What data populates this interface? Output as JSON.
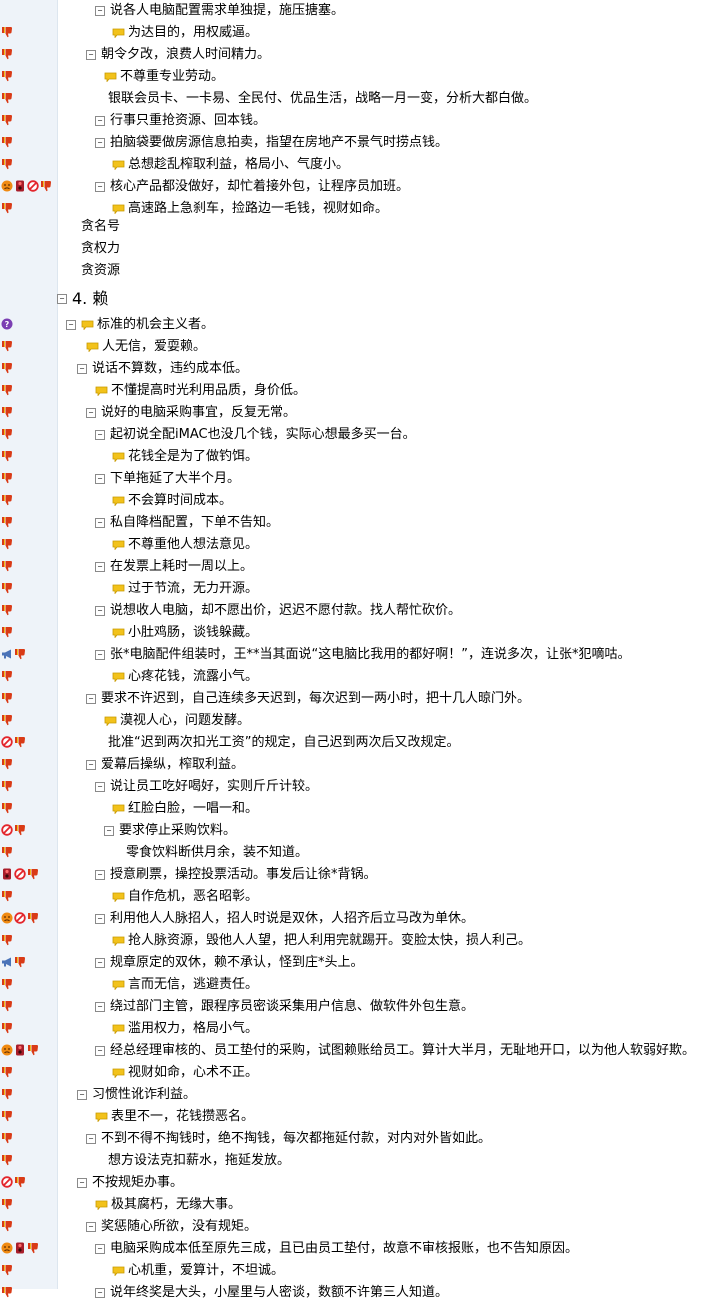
{
  "rows": [
    {
      "text": "说各人电脑配置需求单独提，施压搪塞。",
      "icons": [],
      "toggle": true,
      "note": false
    },
    {
      "text": "为达目的，用权威逼。",
      "icons": [
        "thumb-down"
      ],
      "toggle": false,
      "note": true
    },
    {
      "text": "朝令夕改，浪费人时间精力。",
      "icons": [
        "thumb-down"
      ],
      "toggle": true,
      "note": false
    },
    {
      "text": "不尊重专业劳动。",
      "icons": [
        "thumb-down"
      ],
      "toggle": false,
      "note": true
    },
    {
      "text": "银联会员卡、一卡易、全民付、优品生活，战略一月一变，分析大都白做。",
      "icons": [
        "thumb-down"
      ],
      "toggle": false,
      "note": false
    },
    {
      "text": "行事只重抢资源、回本钱。",
      "icons": [
        "thumb-down"
      ],
      "toggle": true,
      "note": false
    },
    {
      "text": "拍脑袋要做房源信息拍卖，指望在房地产不景气时捞点钱。",
      "icons": [
        "thumb-down"
      ],
      "toggle": true,
      "note": false
    },
    {
      "text": "总想趁乱榨取利益，格局小、气度小。",
      "icons": [
        "thumb-down"
      ],
      "toggle": false,
      "note": true
    },
    {
      "text": "核心产品都没做好，却忙着接外包，让程序员加班。",
      "icons": [
        "angry-face",
        "stop-light",
        "no-sign",
        "thumb-down"
      ],
      "toggle": true,
      "note": false
    },
    {
      "text": "高速路上急刹车，捡路边一毛钱，视财如命。",
      "icons": [
        "thumb-down"
      ],
      "toggle": false,
      "note": true
    },
    {
      "text": "贪名号",
      "icons": [],
      "toggle": false,
      "note": false
    },
    {
      "text": "贪权力",
      "icons": [],
      "toggle": false,
      "note": false
    },
    {
      "text": "贪资源",
      "icons": [],
      "toggle": false,
      "note": false
    },
    {
      "text": "4. 赖",
      "icons": [],
      "toggle": true,
      "note": false,
      "big": true
    },
    {
      "text": "标准的机会主义者。",
      "icons": [
        "question"
      ],
      "toggle": true,
      "note": true
    },
    {
      "text": "人无信，爱耍赖。",
      "icons": [
        "thumb-down"
      ],
      "toggle": false,
      "note": true
    },
    {
      "text": "说话不算数，违约成本低。",
      "icons": [
        "thumb-down"
      ],
      "toggle": true,
      "note": false
    },
    {
      "text": "不懂提高时光利用品质，身价低。",
      "icons": [
        "thumb-down"
      ],
      "toggle": false,
      "note": true
    },
    {
      "text": "说好的电脑采购事宜，反复无常。",
      "icons": [
        "thumb-down"
      ],
      "toggle": true,
      "note": false
    },
    {
      "text": "起初说全配iMAC也没几个钱，实际心想最多买一台。",
      "icons": [
        "thumb-down"
      ],
      "toggle": true,
      "note": false
    },
    {
      "text": "花钱全是为了做钓饵。",
      "icons": [
        "thumb-down"
      ],
      "toggle": false,
      "note": true
    },
    {
      "text": "下单拖延了大半个月。",
      "icons": [
        "thumb-down"
      ],
      "toggle": true,
      "note": false
    },
    {
      "text": "不会算时间成本。",
      "icons": [
        "thumb-down"
      ],
      "toggle": false,
      "note": true
    },
    {
      "text": "私自降档配置，下单不告知。",
      "icons": [
        "thumb-down"
      ],
      "toggle": true,
      "note": false
    },
    {
      "text": "不尊重他人想法意见。",
      "icons": [
        "thumb-down"
      ],
      "toggle": false,
      "note": true
    },
    {
      "text": "在发票上耗时一周以上。",
      "icons": [
        "thumb-down"
      ],
      "toggle": true,
      "note": false
    },
    {
      "text": "过于节流，无力开源。",
      "icons": [
        "thumb-down"
      ],
      "toggle": false,
      "note": true
    },
    {
      "text": "说想收人电脑，却不愿出价，迟迟不愿付款。找人帮忙砍价。",
      "icons": [
        "thumb-down"
      ],
      "toggle": true,
      "note": false
    },
    {
      "text": "小肚鸡肠，谈钱躲藏。",
      "icons": [
        "thumb-down"
      ],
      "toggle": false,
      "note": true
    },
    {
      "text": "张*电脑配件组装时，王**当其面说“这电脑比我用的都好啊！”，连说多次，让张*犯嘀咕。",
      "icons": [
        "megaphone",
        "thumb-down"
      ],
      "toggle": true,
      "note": false
    },
    {
      "text": "心疼花钱，流露小气。",
      "icons": [
        "thumb-down"
      ],
      "toggle": false,
      "note": true
    },
    {
      "text": "要求不许迟到，自己连续多天迟到，每次迟到一两小时，把十几人晾门外。",
      "icons": [
        "thumb-down"
      ],
      "toggle": true,
      "note": false
    },
    {
      "text": "漠视人心，问题发酵。",
      "icons": [
        "thumb-down"
      ],
      "toggle": false,
      "note": true
    },
    {
      "text": "批准“迟到两次扣光工资”的规定，自己迟到两次后又改规定。",
      "icons": [
        "no-sign",
        "thumb-down"
      ],
      "toggle": false,
      "note": false
    },
    {
      "text": "爱幕后操纵，榨取利益。",
      "icons": [
        "thumb-down"
      ],
      "toggle": true,
      "note": false
    },
    {
      "text": "说让员工吃好喝好，实则斤斤计较。",
      "icons": [
        "thumb-down"
      ],
      "toggle": true,
      "note": false
    },
    {
      "text": "红脸白脸，一唱一和。",
      "icons": [
        "thumb-down"
      ],
      "toggle": false,
      "note": true
    },
    {
      "text": "要求停止采购饮料。",
      "icons": [
        "no-sign",
        "thumb-down"
      ],
      "toggle": true,
      "note": false
    },
    {
      "text": "零食饮料断供月余，装不知道。",
      "icons": [
        "thumb-down"
      ],
      "toggle": false,
      "note": false
    },
    {
      "text": "授意刷票，操控投票活动。事发后让徐*背锅。",
      "icons": [
        "stop-light",
        "no-sign",
        "thumb-down"
      ],
      "toggle": true,
      "note": false
    },
    {
      "text": "自作危机，恶名昭彰。",
      "icons": [
        "thumb-down"
      ],
      "toggle": false,
      "note": true
    },
    {
      "text": "利用他人人脉招人，招人时说是双休，人招齐后立马改为单休。",
      "icons": [
        "angry-face",
        "no-sign",
        "thumb-down"
      ],
      "toggle": true,
      "note": false
    },
    {
      "text": "抢人脉资源，毁他人人望，把人利用完就踢开。变脸太快，损人利己。",
      "icons": [
        "thumb-down"
      ],
      "toggle": false,
      "note": true
    },
    {
      "text": "规章原定的双休，赖不承认，怪到庄*头上。",
      "icons": [
        "megaphone",
        "thumb-down"
      ],
      "toggle": true,
      "note": false
    },
    {
      "text": "言而无信，逃避责任。",
      "icons": [
        "thumb-down"
      ],
      "toggle": false,
      "note": true
    },
    {
      "text": "绕过部门主管，跟程序员密谈采集用户信息、做软件外包生意。",
      "icons": [
        "thumb-down"
      ],
      "toggle": true,
      "note": false
    },
    {
      "text": "滥用权力，格局小气。",
      "icons": [
        "thumb-down"
      ],
      "toggle": false,
      "note": true
    },
    {
      "text": "经总经理审核的、员工垫付的采购，试图赖账给员工。算计大半月，无耻地开口，以为他人软弱好欺。",
      "icons": [
        "angry-face",
        "stop-light",
        "thumb-down"
      ],
      "toggle": true,
      "note": false
    },
    {
      "text": "视财如命，心术不正。",
      "icons": [
        "thumb-down"
      ],
      "toggle": false,
      "note": true
    },
    {
      "text": "习惯性讹诈利益。",
      "icons": [
        "thumb-down"
      ],
      "toggle": true,
      "note": false
    },
    {
      "text": "表里不一，花钱攒恶名。",
      "icons": [
        "thumb-down"
      ],
      "toggle": false,
      "note": true
    },
    {
      "text": "不到不得不掏钱时，绝不掏钱，每次都拖延付款，对内对外皆如此。",
      "icons": [
        "thumb-down"
      ],
      "toggle": true,
      "note": false
    },
    {
      "text": "想方设法克扣薪水，拖延发放。",
      "icons": [
        "thumb-down"
      ],
      "toggle": false,
      "note": false
    },
    {
      "text": "不按规矩办事。",
      "icons": [
        "no-sign",
        "thumb-down"
      ],
      "toggle": true,
      "note": false
    },
    {
      "text": "极其腐朽，无缘大事。",
      "icons": [
        "thumb-down"
      ],
      "toggle": false,
      "note": true
    },
    {
      "text": "奖惩随心所欲，没有规矩。",
      "icons": [
        "thumb-down"
      ],
      "toggle": true,
      "note": false
    },
    {
      "text": "电脑采购成本低至原先三成，且已由员工垫付，故意不审核报账，也不告知原因。",
      "icons": [
        "angry-face",
        "stop-light",
        "thumb-down"
      ],
      "toggle": true,
      "note": false
    },
    {
      "text": "心机重，爱算计，不坦诚。",
      "icons": [
        "thumb-down"
      ],
      "toggle": false,
      "note": true
    },
    {
      "text": "说年终奖是大头，小屋里与人密谈，数额不许第三人知道。",
      "icons": [
        "thumb-down"
      ],
      "toggle": true,
      "note": false
    }
  ],
  "toggle_symbol": "⊟",
  "colors": {
    "gutter": "#eef3f9",
    "thumb": "#d93a16",
    "note": "#f2c21b",
    "question": "#7b3fb3",
    "angry": "#f08a12",
    "stop": "#a81d2a",
    "no": "#e3262d",
    "megaphone": "#4a73b8"
  }
}
